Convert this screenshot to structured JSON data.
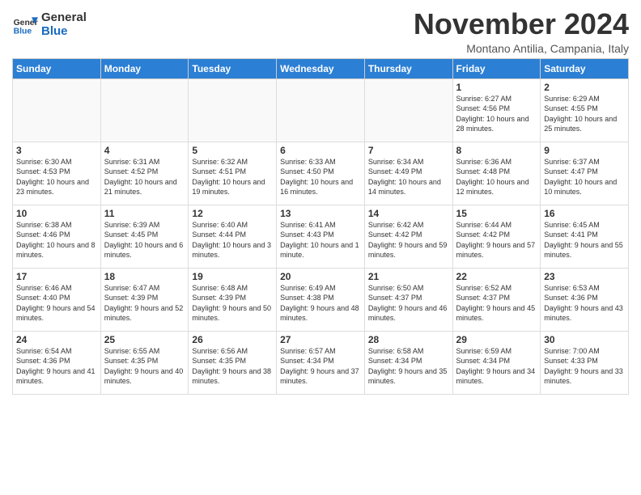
{
  "logo": {
    "line1": "General",
    "line2": "Blue"
  },
  "title": "November 2024",
  "location": "Montano Antilia, Campania, Italy",
  "headers": [
    "Sunday",
    "Monday",
    "Tuesday",
    "Wednesday",
    "Thursday",
    "Friday",
    "Saturday"
  ],
  "weeks": [
    [
      {
        "day": "",
        "info": ""
      },
      {
        "day": "",
        "info": ""
      },
      {
        "day": "",
        "info": ""
      },
      {
        "day": "",
        "info": ""
      },
      {
        "day": "",
        "info": ""
      },
      {
        "day": "1",
        "info": "Sunrise: 6:27 AM\nSunset: 4:56 PM\nDaylight: 10 hours and 28 minutes."
      },
      {
        "day": "2",
        "info": "Sunrise: 6:29 AM\nSunset: 4:55 PM\nDaylight: 10 hours and 25 minutes."
      }
    ],
    [
      {
        "day": "3",
        "info": "Sunrise: 6:30 AM\nSunset: 4:53 PM\nDaylight: 10 hours and 23 minutes."
      },
      {
        "day": "4",
        "info": "Sunrise: 6:31 AM\nSunset: 4:52 PM\nDaylight: 10 hours and 21 minutes."
      },
      {
        "day": "5",
        "info": "Sunrise: 6:32 AM\nSunset: 4:51 PM\nDaylight: 10 hours and 19 minutes."
      },
      {
        "day": "6",
        "info": "Sunrise: 6:33 AM\nSunset: 4:50 PM\nDaylight: 10 hours and 16 minutes."
      },
      {
        "day": "7",
        "info": "Sunrise: 6:34 AM\nSunset: 4:49 PM\nDaylight: 10 hours and 14 minutes."
      },
      {
        "day": "8",
        "info": "Sunrise: 6:36 AM\nSunset: 4:48 PM\nDaylight: 10 hours and 12 minutes."
      },
      {
        "day": "9",
        "info": "Sunrise: 6:37 AM\nSunset: 4:47 PM\nDaylight: 10 hours and 10 minutes."
      }
    ],
    [
      {
        "day": "10",
        "info": "Sunrise: 6:38 AM\nSunset: 4:46 PM\nDaylight: 10 hours and 8 minutes."
      },
      {
        "day": "11",
        "info": "Sunrise: 6:39 AM\nSunset: 4:45 PM\nDaylight: 10 hours and 6 minutes."
      },
      {
        "day": "12",
        "info": "Sunrise: 6:40 AM\nSunset: 4:44 PM\nDaylight: 10 hours and 3 minutes."
      },
      {
        "day": "13",
        "info": "Sunrise: 6:41 AM\nSunset: 4:43 PM\nDaylight: 10 hours and 1 minute."
      },
      {
        "day": "14",
        "info": "Sunrise: 6:42 AM\nSunset: 4:42 PM\nDaylight: 9 hours and 59 minutes."
      },
      {
        "day": "15",
        "info": "Sunrise: 6:44 AM\nSunset: 4:42 PM\nDaylight: 9 hours and 57 minutes."
      },
      {
        "day": "16",
        "info": "Sunrise: 6:45 AM\nSunset: 4:41 PM\nDaylight: 9 hours and 55 minutes."
      }
    ],
    [
      {
        "day": "17",
        "info": "Sunrise: 6:46 AM\nSunset: 4:40 PM\nDaylight: 9 hours and 54 minutes."
      },
      {
        "day": "18",
        "info": "Sunrise: 6:47 AM\nSunset: 4:39 PM\nDaylight: 9 hours and 52 minutes."
      },
      {
        "day": "19",
        "info": "Sunrise: 6:48 AM\nSunset: 4:39 PM\nDaylight: 9 hours and 50 minutes."
      },
      {
        "day": "20",
        "info": "Sunrise: 6:49 AM\nSunset: 4:38 PM\nDaylight: 9 hours and 48 minutes."
      },
      {
        "day": "21",
        "info": "Sunrise: 6:50 AM\nSunset: 4:37 PM\nDaylight: 9 hours and 46 minutes."
      },
      {
        "day": "22",
        "info": "Sunrise: 6:52 AM\nSunset: 4:37 PM\nDaylight: 9 hours and 45 minutes."
      },
      {
        "day": "23",
        "info": "Sunrise: 6:53 AM\nSunset: 4:36 PM\nDaylight: 9 hours and 43 minutes."
      }
    ],
    [
      {
        "day": "24",
        "info": "Sunrise: 6:54 AM\nSunset: 4:36 PM\nDaylight: 9 hours and 41 minutes."
      },
      {
        "day": "25",
        "info": "Sunrise: 6:55 AM\nSunset: 4:35 PM\nDaylight: 9 hours and 40 minutes."
      },
      {
        "day": "26",
        "info": "Sunrise: 6:56 AM\nSunset: 4:35 PM\nDaylight: 9 hours and 38 minutes."
      },
      {
        "day": "27",
        "info": "Sunrise: 6:57 AM\nSunset: 4:34 PM\nDaylight: 9 hours and 37 minutes."
      },
      {
        "day": "28",
        "info": "Sunrise: 6:58 AM\nSunset: 4:34 PM\nDaylight: 9 hours and 35 minutes."
      },
      {
        "day": "29",
        "info": "Sunrise: 6:59 AM\nSunset: 4:34 PM\nDaylight: 9 hours and 34 minutes."
      },
      {
        "day": "30",
        "info": "Sunrise: 7:00 AM\nSunset: 4:33 PM\nDaylight: 9 hours and 33 minutes."
      }
    ]
  ]
}
